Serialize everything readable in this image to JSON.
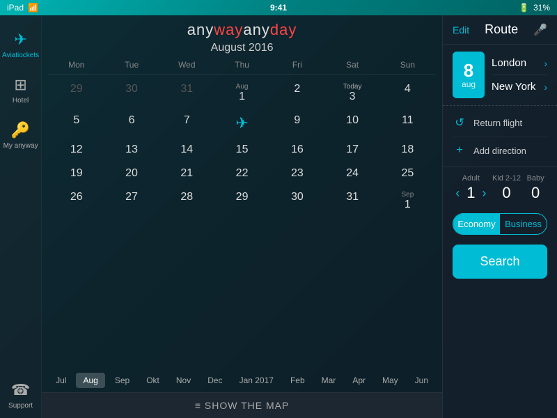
{
  "statusBar": {
    "left": "iPad",
    "time": "9:41",
    "battery": "31%"
  },
  "appTitle": {
    "part1": "any",
    "part2": "way",
    "part3": "any",
    "part4": "day"
  },
  "calendarMonth": "August 2016",
  "calendarHeaders": [
    "Mon",
    "Tue",
    "Wed",
    "Thu",
    "Fri",
    "Sat",
    "Sun"
  ],
  "calendarRows": [
    [
      {
        "label": "29",
        "type": "other-month"
      },
      {
        "label": "30",
        "type": "other-month"
      },
      {
        "label": "31",
        "type": "other-month"
      },
      {
        "label": "1",
        "type": "normal",
        "sublabel": "Aug"
      },
      {
        "label": "2",
        "type": "normal"
      },
      {
        "label": "3",
        "type": "today"
      },
      {
        "label": "4",
        "type": "normal"
      }
    ],
    [
      {
        "label": "5",
        "type": "normal"
      },
      {
        "label": "6",
        "type": "normal"
      },
      {
        "label": "7",
        "type": "normal"
      },
      {
        "label": "✈",
        "type": "flight"
      },
      {
        "label": "9",
        "type": "normal"
      },
      {
        "label": "10",
        "type": "normal"
      },
      {
        "label": "11",
        "type": "normal"
      }
    ],
    [
      {
        "label": "12",
        "type": "normal"
      },
      {
        "label": "13",
        "type": "normal"
      },
      {
        "label": "14",
        "type": "normal"
      },
      {
        "label": "15",
        "type": "normal"
      },
      {
        "label": "16",
        "type": "normal"
      },
      {
        "label": "17",
        "type": "normal"
      },
      {
        "label": "18",
        "type": "normal"
      }
    ],
    [
      {
        "label": "19",
        "type": "normal"
      },
      {
        "label": "20",
        "type": "normal"
      },
      {
        "label": "21",
        "type": "normal"
      },
      {
        "label": "22",
        "type": "normal"
      },
      {
        "label": "23",
        "type": "normal"
      },
      {
        "label": "24",
        "type": "normal"
      },
      {
        "label": "25",
        "type": "normal"
      }
    ],
    [
      {
        "label": "26",
        "type": "normal"
      },
      {
        "label": "27",
        "type": "normal"
      },
      {
        "label": "28",
        "type": "normal"
      },
      {
        "label": "29",
        "type": "normal"
      },
      {
        "label": "30",
        "type": "normal"
      },
      {
        "label": "31",
        "type": "normal"
      },
      {
        "label": "1",
        "type": "other-month",
        "sublabel": "Sep"
      }
    ]
  ],
  "monthNav": [
    {
      "label": "Jul",
      "active": false
    },
    {
      "label": "Aug",
      "active": true
    },
    {
      "label": "Sep",
      "active": false
    },
    {
      "label": "Okt",
      "active": false
    },
    {
      "label": "Nov",
      "active": false
    },
    {
      "label": "Dec",
      "active": false
    },
    {
      "label": "Jan 2017",
      "active": false
    },
    {
      "label": "Feb",
      "active": false
    },
    {
      "label": "Mar",
      "active": false
    },
    {
      "label": "Apr",
      "active": false
    },
    {
      "label": "May",
      "active": false
    },
    {
      "label": "Jun",
      "active": false
    }
  ],
  "showMap": "SHOW THE MAP",
  "sidebar": {
    "items": [
      {
        "label": "Aviatiockets",
        "icon": "✈",
        "active": true
      },
      {
        "label": "Hotel",
        "icon": "⊞",
        "active": false
      },
      {
        "label": "My anyway",
        "icon": "🔑",
        "active": false
      },
      {
        "label": "Support",
        "icon": "☎",
        "active": false
      }
    ]
  },
  "routePanel": {
    "editLabel": "Edit",
    "titleLabel": "Route",
    "micIcon": "🎤",
    "dateBadge": {
      "num": "8",
      "month": "aug"
    },
    "destinations": [
      {
        "label": "London"
      },
      {
        "label": "New York"
      }
    ],
    "actions": [
      {
        "icon": "↺",
        "label": "Return flight"
      },
      {
        "icon": "+",
        "label": "Add direction"
      }
    ],
    "passengers": [
      {
        "type": "Adult",
        "count": "1",
        "showArrows": true
      },
      {
        "type": "Kid 2-12",
        "count": "0",
        "showArrows": false
      },
      {
        "type": "Baby",
        "count": "0",
        "showArrows": false
      }
    ],
    "classes": [
      {
        "label": "Economy",
        "active": true
      },
      {
        "label": "Business",
        "active": false
      }
    ],
    "searchLabel": "Search"
  }
}
